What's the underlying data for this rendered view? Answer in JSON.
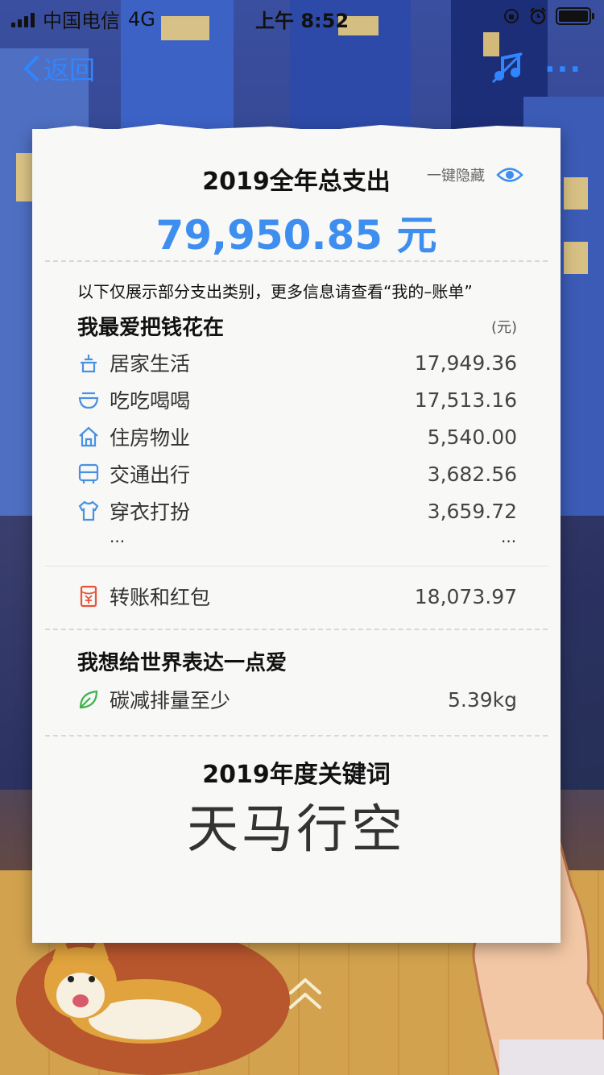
{
  "status_bar": {
    "carrier": "中国电信",
    "network": "4G",
    "time": "上午 8:52"
  },
  "nav": {
    "back_label": "返回",
    "more_label": "···"
  },
  "summary": {
    "title": "2019全年总支出",
    "hide_label": "一键隐藏",
    "total": "79,950.85 元",
    "note": "以下仅展示部分支出类别，更多信息请查看“我的–账单”"
  },
  "spending": {
    "section_title": "我最爱把钱花在",
    "unit": "(元)",
    "items": [
      {
        "label": "居家生活",
        "value": "17,949.36",
        "icon": "home-life-icon"
      },
      {
        "label": "吃吃喝喝",
        "value": "17,513.16",
        "icon": "food-bowl-icon"
      },
      {
        "label": "住房物业",
        "value": "5,540.00",
        "icon": "house-icon"
      },
      {
        "label": "交通出行",
        "value": "3,682.56",
        "icon": "bus-icon"
      },
      {
        "label": "穿衣打扮",
        "value": "3,659.72",
        "icon": "shirt-icon"
      }
    ],
    "ellipsis": "...",
    "transfer": {
      "label": "转账和红包",
      "value": "18,073.97",
      "icon": "red-envelope-icon"
    }
  },
  "love": {
    "section_title": "我想给世界表达一点爱",
    "item": {
      "label": "碳减排量至少",
      "value": "5.39kg",
      "icon": "leaf-icon"
    }
  },
  "keyword": {
    "title": "2019年度关键词",
    "word": "天马行空"
  },
  "colors": {
    "accent_blue": "#3e8ef0",
    "nav_blue": "#2f86ff",
    "icon_blue": "#4a90e2",
    "transfer_red": "#e8533a",
    "leaf_green": "#3fb34f"
  }
}
